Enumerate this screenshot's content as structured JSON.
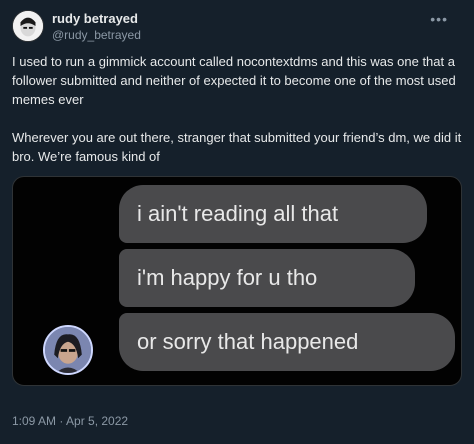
{
  "author": {
    "display_name": "rudy betrayed",
    "handle": "@rudy_betrayed"
  },
  "menu_icon": "more-horizontal-icon",
  "tweet": {
    "paragraphs": [
      "I used to run a gimmick account called nocontextdms and this was one that a follower submitted and neither of expected it to become one of the most used memes ever",
      "Wherever you are out there, stranger that submitted your friend’s dm, we did it bro. We’re famous kind of"
    ]
  },
  "media": {
    "messages": [
      "i ain't reading all that",
      "i'm happy for u tho",
      "or sorry that happened"
    ]
  },
  "meta": {
    "timestamp": "1:09 AM · Apr 5, 2022"
  },
  "colors": {
    "background": "#15202b",
    "bubble": "#4a4a4c",
    "secondary_text": "#8b98a5"
  }
}
